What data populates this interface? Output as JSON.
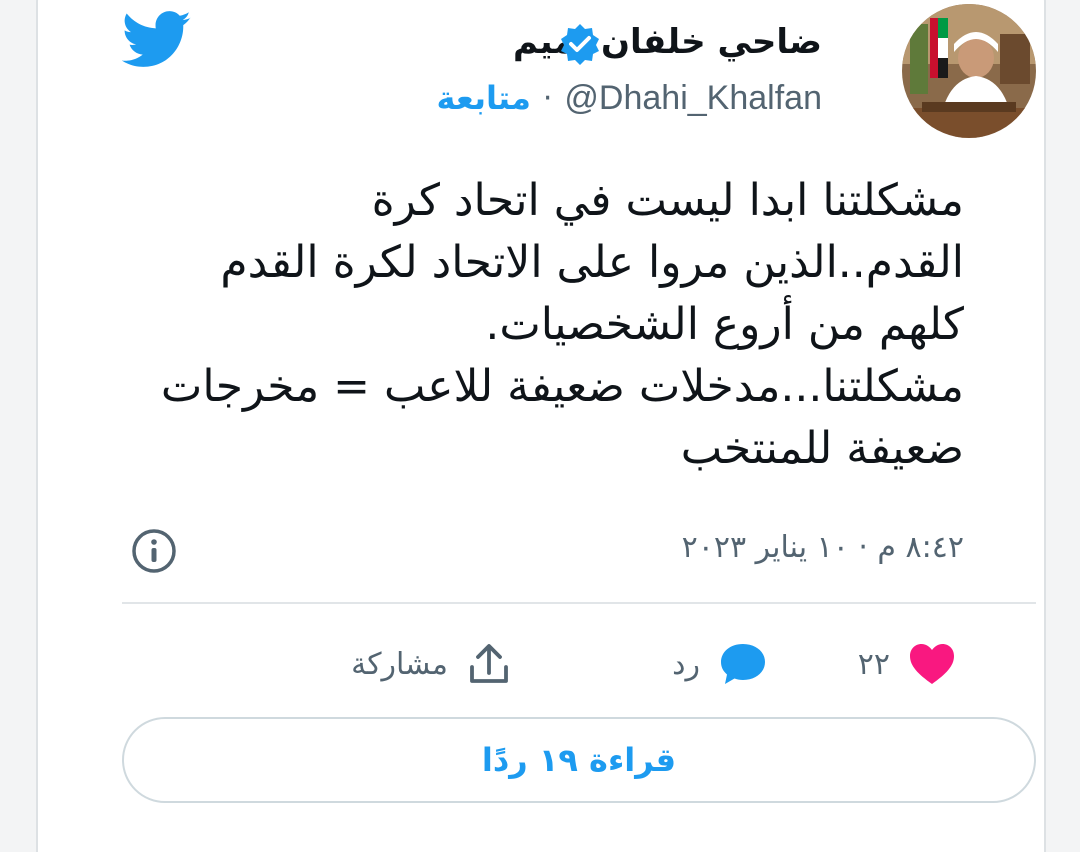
{
  "author": {
    "display_name": "ضاحي خلفان تميم",
    "handle": "@Dhahi_Khalfan",
    "separator": "·",
    "follow_label": "متابعة"
  },
  "tweet": {
    "text": "مشكلتنا ابدا ليست في اتحاد كرة القدم..الذين مروا على الاتحاد لكرة القدم كلهم من أروع الشخصيات.\nمشكلتنا...مدخلات ضعيفة للاعب = مخرجات ضعيفة للمنتخب",
    "timestamp": "٨:٤٢ م · ١٠ يناير ٢٠٢٣"
  },
  "actions": {
    "like_count": "٢٢",
    "reply_label": "رد",
    "share_label": "مشاركة"
  },
  "read_replies_label": "قراءة ١٩ ردًا",
  "colors": {
    "brand_blue": "#1d9bf0",
    "like_pink": "#f91880",
    "text_primary": "#0f1419",
    "text_secondary": "#536471"
  },
  "icons": [
    "twitter-logo-icon",
    "verified-badge-icon",
    "info-icon",
    "heart-icon",
    "reply-bubble-icon",
    "share-icon"
  ]
}
